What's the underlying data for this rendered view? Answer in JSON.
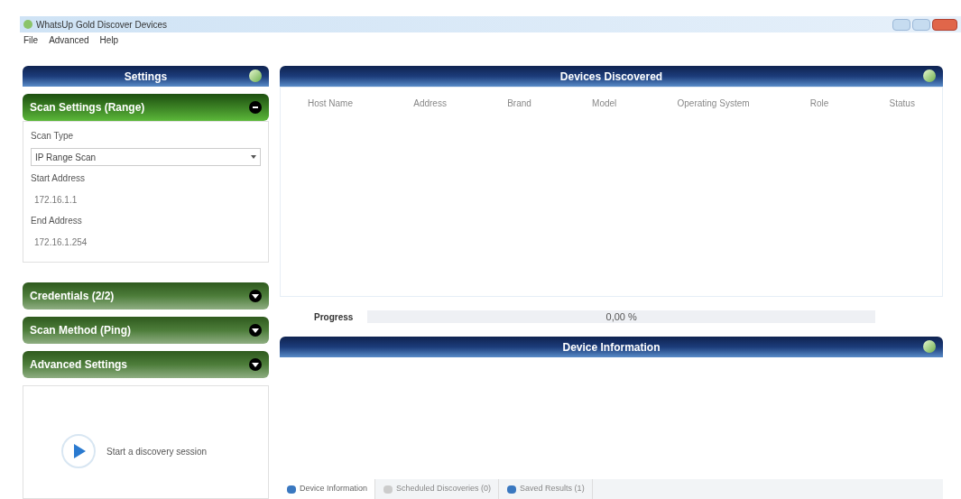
{
  "window": {
    "title": "WhatsUp Gold Discover Devices"
  },
  "menu": [
    "File",
    "Advanced",
    "Help"
  ],
  "settings": {
    "title": "Settings",
    "sections": [
      {
        "title": "Scan Settings (Range)",
        "expanded": true
      },
      {
        "title": "Credentials (2/2)",
        "expanded": false
      },
      {
        "title": "Scan Method (Ping)",
        "expanded": false
      },
      {
        "title": "Advanced Settings",
        "expanded": false
      }
    ],
    "scan_type_label": "Scan Type",
    "scan_type": "IP Range Scan",
    "start_label": "Start Address",
    "start_value": "172.16.1.1",
    "end_label": "End Address",
    "end_value": "172.16.1.254",
    "start_button": "Start a discovery session"
  },
  "devices": {
    "title": "Devices Discovered",
    "columns": [
      "Host Name",
      "Address",
      "Brand",
      "Model",
      "Operating System",
      "Role",
      "Status"
    ]
  },
  "progress": {
    "label": "Progress",
    "reading": "0,00 %"
  },
  "device_info": {
    "title": "Device Information"
  },
  "tabs": [
    {
      "label": "Device Information",
      "selected": true
    },
    {
      "label": "Scheduled Discoveries (0)",
      "selected": false
    },
    {
      "label": "Saved Results (1)",
      "selected": false
    }
  ]
}
